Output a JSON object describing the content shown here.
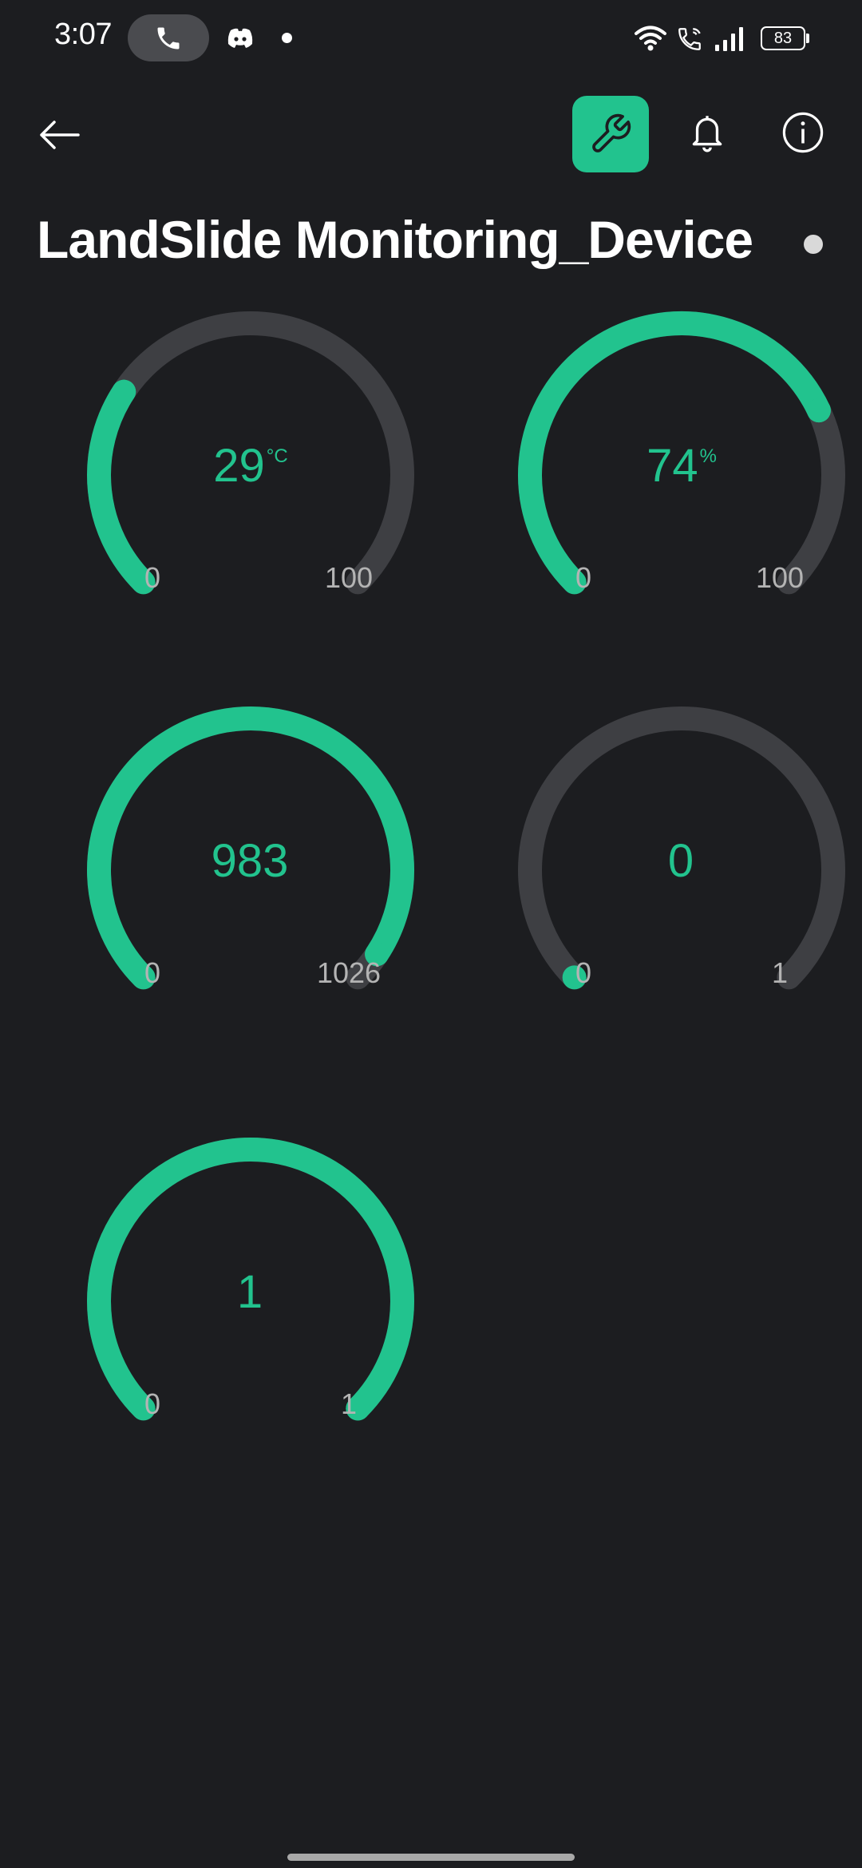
{
  "status_bar": {
    "time": "3:07",
    "battery": "83",
    "icons": [
      "phone-call-icon",
      "discord-icon",
      "wifi-icon",
      "wifi-calling-icon",
      "signal-icon",
      "battery-icon"
    ]
  },
  "app_bar": {
    "back_icon": "arrow-left-icon",
    "actions": [
      "wrench-icon",
      "bell-icon",
      "info-icon"
    ],
    "active_color": "#22c38e"
  },
  "device": {
    "title": "LandSlide Monitoring_Device",
    "status": "offline"
  },
  "gauges": [
    {
      "value": "29",
      "unit": "°C",
      "min": "0",
      "max": "100",
      "level": 0.29
    },
    {
      "value": "74",
      "unit": "%",
      "min": "0",
      "max": "100",
      "level": 0.74
    },
    {
      "value": "983",
      "unit": "",
      "min": "0",
      "max": "1026",
      "level": 0.958
    },
    {
      "value": "0",
      "unit": "",
      "min": "0",
      "max": "1",
      "level": 0
    },
    {
      "value": "1",
      "unit": "",
      "min": "0",
      "max": "1",
      "level": 1
    }
  ],
  "colors": {
    "background": "#1c1d20",
    "accent": "#22c38e",
    "track": "#3e3f43",
    "label": "#b4b4b4"
  }
}
